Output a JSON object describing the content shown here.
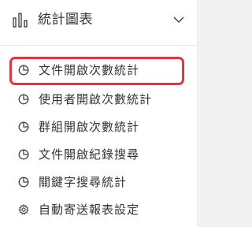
{
  "header": {
    "title": "統計圖表",
    "icon": "bar-chart-icon",
    "toggle_icon": "chevron-down-icon"
  },
  "menu": {
    "items": [
      {
        "label": "文件開啟次數統計",
        "icon": "pie-chart-icon",
        "active": true
      },
      {
        "label": "使用者開啟次數統計",
        "icon": "pie-chart-icon",
        "active": false
      },
      {
        "label": "群組開啟次數統計",
        "icon": "pie-chart-icon",
        "active": false
      },
      {
        "label": "文件開啟紀錄搜尋",
        "icon": "pie-chart-icon",
        "active": false
      },
      {
        "label": "關鍵字搜尋統計",
        "icon": "pie-chart-icon",
        "active": false
      },
      {
        "label": "自動寄送報表設定",
        "icon": "gear-icon",
        "active": false
      }
    ]
  },
  "colors": {
    "highlight_border": "#e8323f",
    "text": "#333333",
    "icon": "#444444"
  }
}
